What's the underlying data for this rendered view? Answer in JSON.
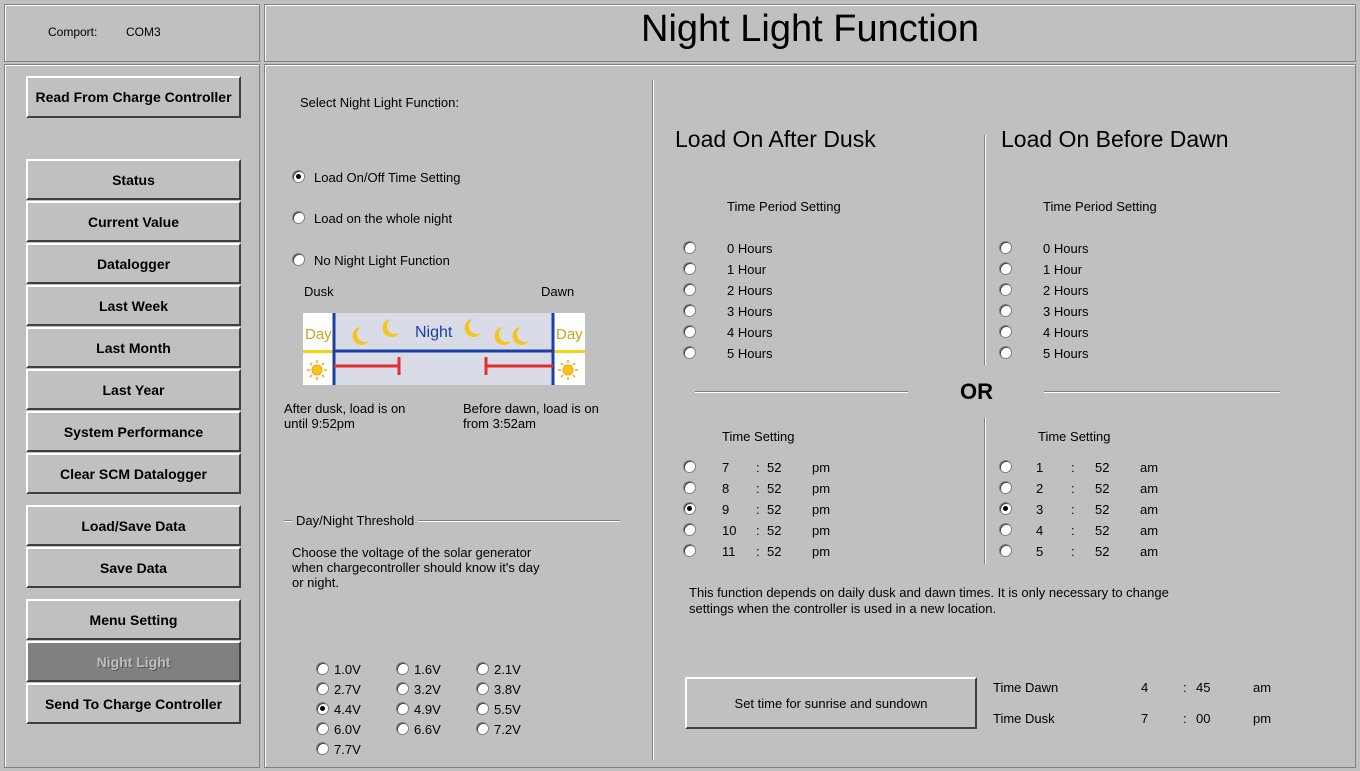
{
  "header": {
    "comport_label": "Comport:",
    "comport_value": "COM3",
    "title": "Night Light Function"
  },
  "nav": {
    "read": "Read From Charge Controller",
    "items": [
      "Status",
      "Current Value",
      "Datalogger",
      "Last Week",
      "Last Month",
      "Last Year",
      "System Performance",
      "Clear SCM Datalogger"
    ],
    "load_save": "Load/Save Data",
    "save": "Save Data",
    "menu_setting": "Menu Setting",
    "night_light": "Night Light",
    "send": "Send To Charge Controller"
  },
  "function_select": {
    "heading": "Select Night Light Function:",
    "options": [
      "Load On/Off Time Setting",
      "Load on the whole night",
      "No Night Light Function"
    ],
    "selected_index": 0
  },
  "diagram": {
    "dusk": "Dusk",
    "dawn": "Dawn",
    "day_left": "Day",
    "day_right": "Day",
    "night": "Night",
    "after_dusk_line1": "After dusk, load is on",
    "after_dusk_line2": "until 9:52pm",
    "before_dawn_line1": "Before dawn, load is on",
    "before_dawn_line2": "from 3:52am"
  },
  "threshold": {
    "group_label": "Day/Night Threshold",
    "description_line1": "Choose the voltage of the solar generator",
    "description_line2": "when chargecontroller should know it's day",
    "description_line3": "or night.",
    "options": [
      "1.0V",
      "1.6V",
      "2.1V",
      "2.7V",
      "3.2V",
      "3.8V",
      "4.4V",
      "4.9V",
      "5.5V",
      "6.0V",
      "6.6V",
      "7.2V",
      "7.7V"
    ],
    "selected_index": 6
  },
  "after_dusk": {
    "title": "Load On After Dusk",
    "period_heading": "Time Period Setting",
    "periods": [
      "0 Hours",
      "1 Hour",
      "2 Hours",
      "3 Hours",
      "4 Hours",
      "5 Hours"
    ],
    "time_heading": "Time Setting",
    "times": [
      {
        "h": "7",
        "m": "52",
        "ap": "pm"
      },
      {
        "h": "8",
        "m": "52",
        "ap": "pm"
      },
      {
        "h": "9",
        "m": "52",
        "ap": "pm"
      },
      {
        "h": "10",
        "m": "52",
        "ap": "pm"
      },
      {
        "h": "11",
        "m": "52",
        "ap": "pm"
      }
    ],
    "selected_time_index": 2
  },
  "before_dawn": {
    "title": "Load On Before Dawn",
    "period_heading": "Time Period Setting",
    "periods": [
      "0 Hours",
      "1 Hour",
      "2 Hours",
      "3 Hours",
      "4 Hours",
      "5 Hours"
    ],
    "time_heading": "Time Setting",
    "times": [
      {
        "h": "1",
        "m": "52",
        "ap": "am"
      },
      {
        "h": "2",
        "m": "52",
        "ap": "am"
      },
      {
        "h": "3",
        "m": "52",
        "ap": "am"
      },
      {
        "h": "4",
        "m": "52",
        "ap": "am"
      },
      {
        "h": "5",
        "m": "52",
        "ap": "am"
      }
    ],
    "selected_time_index": 2
  },
  "or_label": "OR",
  "note_line1": "This function depends on daily dusk and dawn times.  It is only necessary to change",
  "note_line2": "settings when the controller is used in a new location.",
  "sun_button": "Set time for sunrise and sundown",
  "dawn_time": {
    "label": "Time Dawn",
    "h": "4",
    "m": "45",
    "ap": "am"
  },
  "dusk_time": {
    "label": "Time Dusk",
    "h": "7",
    "m": "00",
    "ap": "pm"
  },
  "colon": ":",
  "colors": {
    "background": "#c0c0c0",
    "night_line": "#1a3fa8",
    "load_bar": "#e03030",
    "day_band": "#f5d21a"
  }
}
